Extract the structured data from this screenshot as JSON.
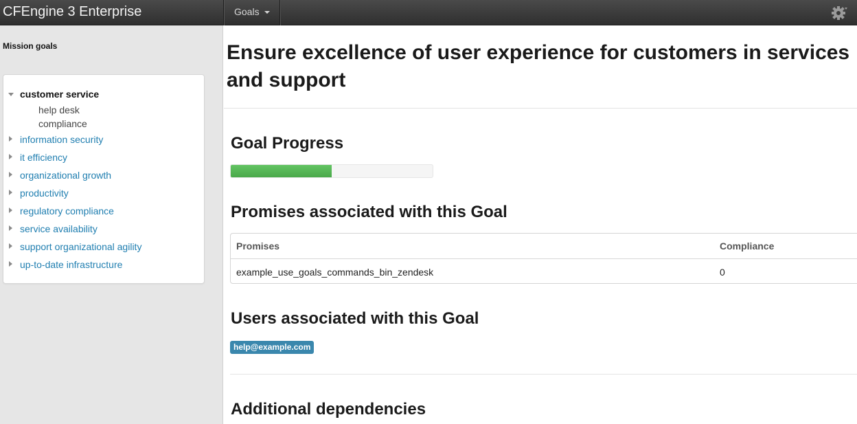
{
  "navbar": {
    "brand": "CFEngine 3 Enterprise",
    "goals_menu": "Goals",
    "settings_icon": "gear-icon"
  },
  "sidebar": {
    "title": "Mission goals",
    "items": [
      {
        "label": "customer service",
        "expanded": true,
        "children": [
          "help desk",
          "compliance"
        ]
      },
      {
        "label": "information security"
      },
      {
        "label": "it efficiency"
      },
      {
        "label": "organizational growth"
      },
      {
        "label": "productivity"
      },
      {
        "label": "regulatory compliance"
      },
      {
        "label": "service availability"
      },
      {
        "label": "support organizational agility"
      },
      {
        "label": "up-to-date infrastructure"
      }
    ]
  },
  "main": {
    "title": "Ensure excellence of user experience for customers in services and support",
    "progress_heading": "Goal Progress",
    "progress_fraction": 0.5,
    "progress_color": "#5cb85c",
    "promises_heading": "Promises associated with this Goal",
    "promises_table": {
      "headers": [
        "Promises",
        "Compliance"
      ],
      "rows": [
        [
          "example_use_goals_commands_bin_zendesk",
          "0"
        ]
      ]
    },
    "users_heading": "Users associated with this Goal",
    "users": [
      "help@example.com"
    ],
    "dependencies_heading": "Additional dependencies"
  }
}
